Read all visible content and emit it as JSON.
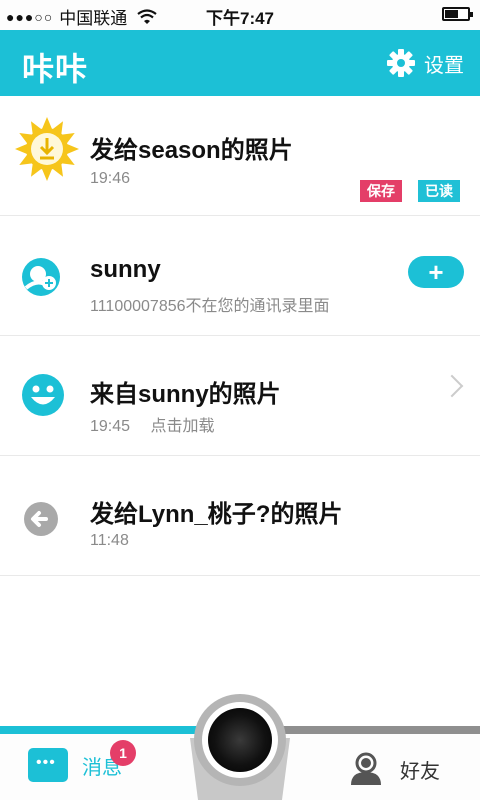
{
  "status_bar": {
    "carrier": "中国联通",
    "time": "下午7:47",
    "battery_level": 0.6
  },
  "header": {
    "logo": "咔咔",
    "settings_label": "设置"
  },
  "items": [
    {
      "title": "发给season的照片",
      "time": "19:46",
      "badges": [
        "保存",
        "已读"
      ]
    },
    {
      "title": "sunny",
      "subtitle": "11100007856不在您的通讯录里面",
      "action": "+"
    },
    {
      "title": "来自sunny的照片",
      "time": "19:45",
      "extra": "点击加载"
    },
    {
      "title": "发给Lynn_桃子?的照片",
      "time": "11:48"
    }
  ],
  "tabbar": {
    "messages_label": "消息",
    "messages_badge": "1",
    "friends_label": "好友"
  },
  "colors": {
    "accent": "#1cc0d6",
    "badge_red": "#e43e68",
    "sun_yellow": "#f6c51b"
  }
}
